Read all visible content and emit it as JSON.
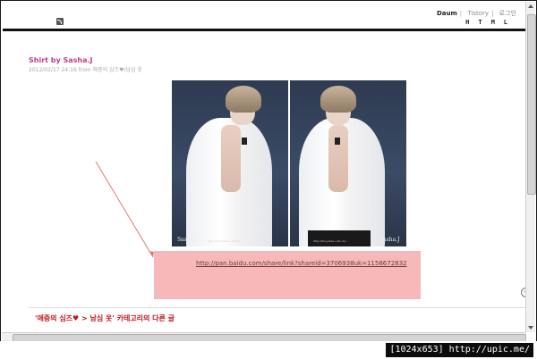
{
  "header": {
    "links": [
      "Daum",
      "Tistory",
      "로그인"
    ],
    "html_letters": "HTML"
  },
  "post": {
    "title": "Shirt by Sasha.J",
    "meta": "2012/02/17 24:16 from 애증의 심즈♥/남심 옷",
    "watermark_left": "Sasha.J",
    "watermark_left_url": "http://blog.sina.com.cn/...",
    "watermark_right": "Sasha.J",
    "watermark_right_url": "http://blog.sina.com.cn/...",
    "download_link": "http://pan.baidu.com/share/link?shareid=3706938uk=1158672832"
  },
  "related": {
    "category_prefix": "'애증의 심즈♥ > ",
    "category_name": "남심 옷",
    "suffix": "' 카테고리의 다른 글"
  },
  "footer_text": "...",
  "badge": "[1024x653] http://upic.me/"
}
